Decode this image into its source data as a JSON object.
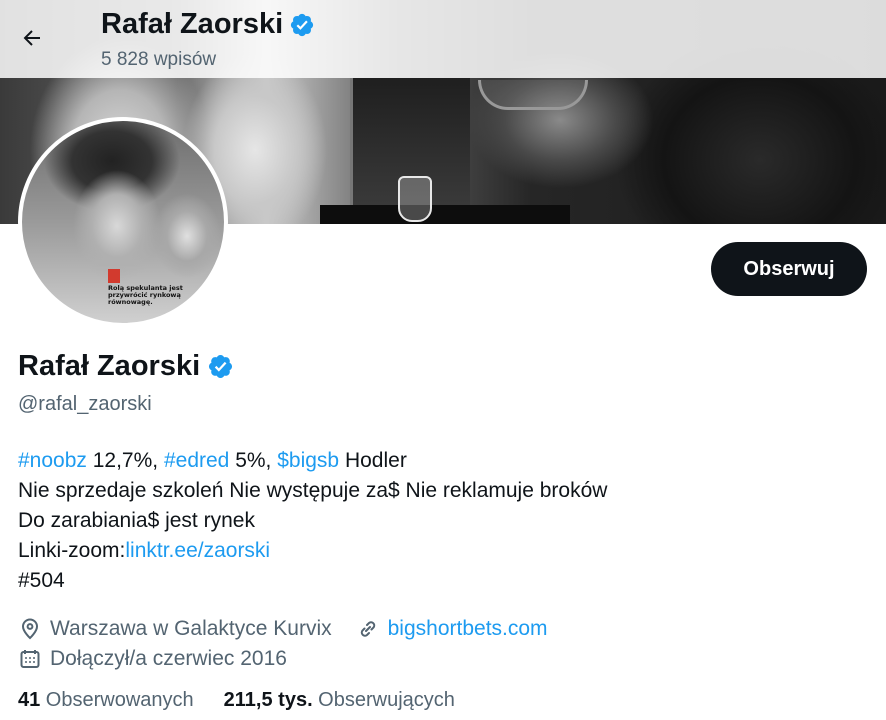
{
  "header": {
    "name": "Rafał Zaorski",
    "post_count": "5 828 wpisów"
  },
  "profile": {
    "name": "Rafał Zaorski",
    "handle": "@rafal_zaorski",
    "follow_label": "Obserwuj",
    "avatar_quote": "Rolą spekulanta jest przywrócić rynkową równowagę.",
    "bio": {
      "line1": {
        "tag1": "#noobz",
        "text1": " 12,7%, ",
        "tag2": "#edred",
        "text2": "  5%, ",
        "tag3": "$bigsb",
        "text3": " Hodler"
      },
      "line2": "Nie sprzedaje szkoleń Nie występuje za$ Nie reklamuje broków",
      "line3": "Do zarabiania$ jest rynek",
      "line4_prefix": "Linki-zoom:",
      "line4_link": "linktr.ee/zaorski",
      "line5": "#504"
    },
    "location": "Warszawa w Galaktyce Kurvix",
    "website": "bigshortbets.com",
    "joined": "Dołączył/a czerwiec 2016",
    "following_count": "41",
    "following_label": " Obserwowanych",
    "followers_count": "211,5 tys.",
    "followers_label": " Obserwujących"
  },
  "icons": {
    "back": "arrow-left-icon",
    "verified": "verified-badge-icon",
    "location": "map-pin-icon",
    "link": "link-icon",
    "calendar": "calendar-icon"
  },
  "colors": {
    "accent": "#1d9bf0",
    "text": "#0f1419",
    "secondary": "#536471",
    "button_bg": "#0f1419"
  }
}
